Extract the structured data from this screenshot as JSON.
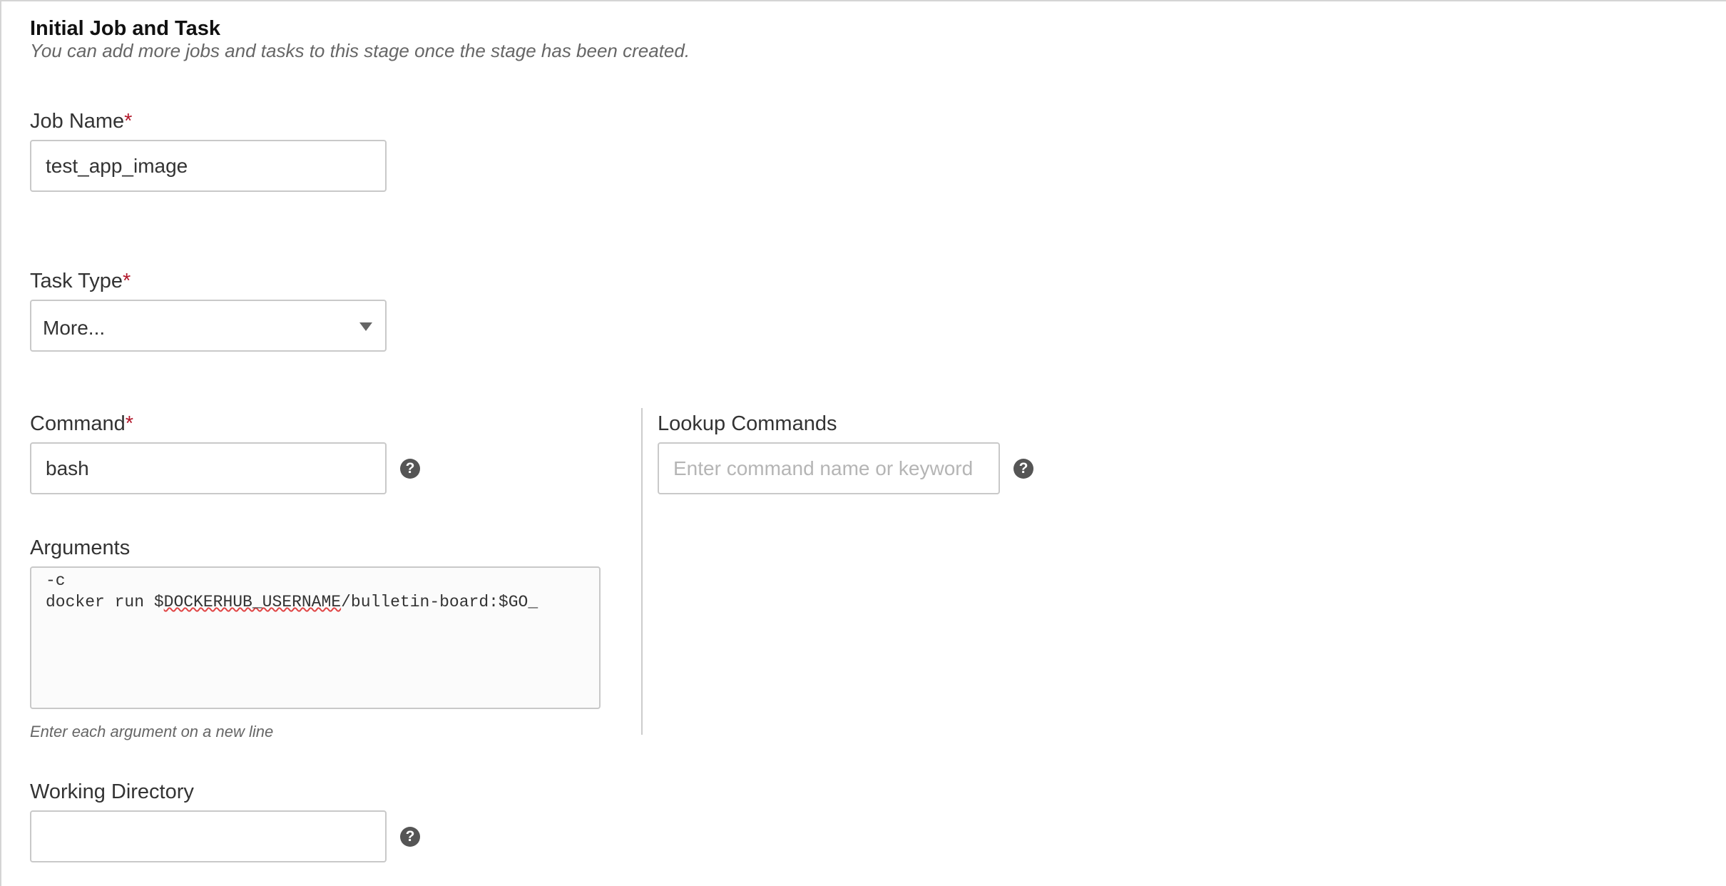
{
  "section": {
    "title": "Initial Job and Task",
    "subtitle": "You can add more jobs and tasks to this stage once the stage has been created."
  },
  "job_name": {
    "label": "Job Name",
    "required_mark": "*",
    "value": "test_app_image"
  },
  "task_type": {
    "label": "Task Type",
    "required_mark": "*",
    "selected": "More..."
  },
  "command": {
    "label": "Command",
    "required_mark": "*",
    "value": "bash",
    "help_icon": "question-circle-icon"
  },
  "lookup": {
    "label": "Lookup Commands",
    "placeholder": "Enter command name or keyword",
    "help_icon": "question-circle-icon"
  },
  "arguments": {
    "label": "Arguments",
    "line1": "-c",
    "line2_prefix": "docker run $",
    "line2_flagged": "DOCKERHUB_USERNAME",
    "line2_suffix": "/bulletin-board:$GO_",
    "hint": "Enter each argument on a new line"
  },
  "working_directory": {
    "label": "Working Directory",
    "value": "",
    "help_icon": "question-circle-icon"
  },
  "colors": {
    "required": "#b2182b",
    "border": "#c9c9c9",
    "help_icon_bg": "#555555",
    "spellcheck": "#e04545"
  }
}
